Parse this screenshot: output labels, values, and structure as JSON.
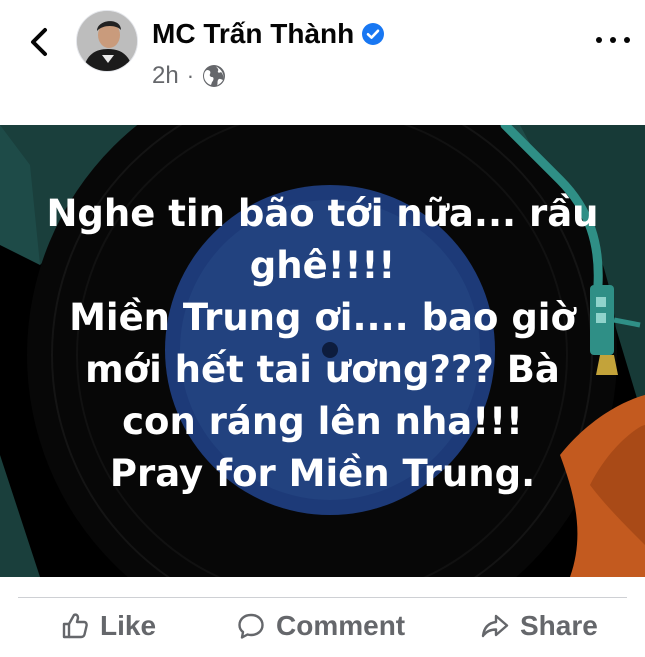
{
  "header": {
    "back_icon": "chevron-left-icon",
    "page_name": "MC Trấn Thành",
    "verified_icon": "verified-badge-icon",
    "timestamp": "2h",
    "separator": "·",
    "audience_icon": "globe-icon",
    "more_icon": "more-horizontal-icon"
  },
  "post": {
    "text_lines": [
      "Nghe tin bão tới nữa... rầu",
      "ghê!!!!",
      "Miền Trung ơi.... bao giờ",
      "mới hết tai ương??? Bà",
      "con ráng lên nha!!!",
      "Pray for Miền Trung."
    ],
    "colors": {
      "background": "#000000",
      "disc": "#1d3a78",
      "accent_teal": "#1e4b48",
      "accent_orange": "#c35a1f",
      "text": "#ffffff"
    }
  },
  "actions": {
    "like_label": "Like",
    "like_icon": "thumbs-up-icon",
    "comment_label": "Comment",
    "comment_icon": "comment-bubble-icon",
    "share_label": "Share",
    "share_icon": "share-arrow-icon"
  }
}
